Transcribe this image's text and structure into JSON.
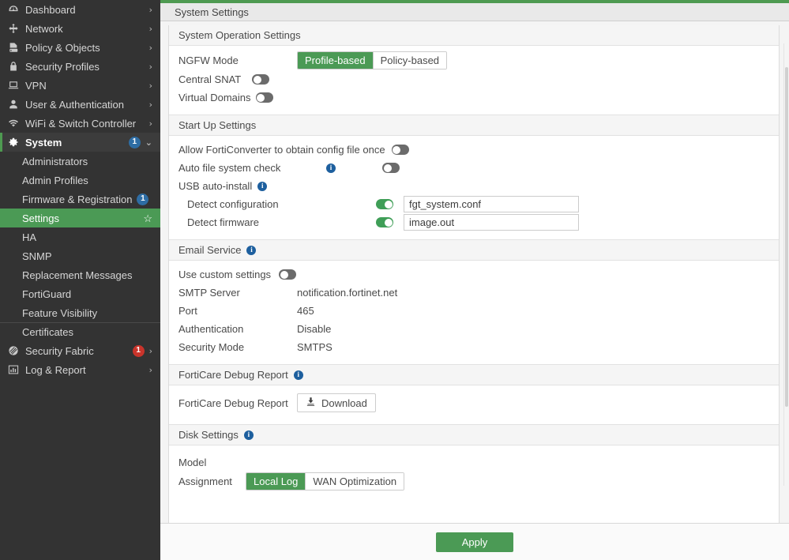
{
  "theme": {
    "brand_green": "#4b9a55",
    "sidebar_bg": "#333333",
    "badge_blue": "#2e6da4",
    "badge_red": "#c9342b",
    "info_blue": "#1d5f9e"
  },
  "sidebar": {
    "items": [
      {
        "label": "Dashboard",
        "icon": "dashboard-gauge-icon",
        "chevron": "›"
      },
      {
        "label": "Network",
        "icon": "network-arrows-icon",
        "chevron": "›"
      },
      {
        "label": "Policy & Objects",
        "icon": "policy-icon",
        "chevron": "›"
      },
      {
        "label": "Security Profiles",
        "icon": "lock-icon",
        "chevron": "›"
      },
      {
        "label": "VPN",
        "icon": "monitor-icon",
        "chevron": "›"
      },
      {
        "label": "User & Authentication",
        "icon": "user-icon",
        "chevron": "›"
      },
      {
        "label": "WiFi & Switch Controller",
        "icon": "wifi-icon",
        "chevron": "›"
      },
      {
        "label": "System",
        "icon": "gear-icon",
        "chevron": "⌄",
        "badge": "1",
        "badge_color": "blue",
        "open": true
      }
    ],
    "system_children": [
      {
        "label": "Administrators"
      },
      {
        "label": "Admin Profiles"
      },
      {
        "label": "Firmware & Registration",
        "badge": "1",
        "badge_color": "blue"
      },
      {
        "label": "Settings",
        "active": true,
        "star": "☆"
      },
      {
        "label": "HA"
      },
      {
        "label": "SNMP"
      },
      {
        "label": "Replacement Messages"
      },
      {
        "label": "FortiGuard"
      },
      {
        "label": "Feature Visibility"
      },
      {
        "label": "Certificates",
        "separator": true
      }
    ],
    "items_after": [
      {
        "label": "Security Fabric",
        "icon": "fabric-icon",
        "chevron": "›",
        "badge": "1",
        "badge_color": "red"
      },
      {
        "label": "Log & Report",
        "icon": "chart-bar-icon",
        "chevron": "›"
      }
    ]
  },
  "header": {
    "title": "System Settings"
  },
  "sections": {
    "system_operation": {
      "title": "System Operation Settings",
      "ngfw_mode": {
        "label": "NGFW Mode",
        "options": [
          "Profile-based",
          "Policy-based"
        ],
        "selected": "Profile-based"
      },
      "central_snat": {
        "label": "Central SNAT",
        "state": "off"
      },
      "virtual_domains": {
        "label": "Virtual Domains",
        "state": "off"
      }
    },
    "start_up": {
      "title": "Start Up Settings",
      "forticonverter": {
        "label": "Allow FortiConverter to obtain config file once",
        "state": "off"
      },
      "auto_file_check": {
        "label": "Auto file system check",
        "state": "off",
        "info": "i"
      },
      "usb_auto_install": {
        "label": "USB auto-install",
        "info": "i"
      },
      "detect_configuration": {
        "label": "Detect configuration",
        "state": "on",
        "value": "fgt_system.conf",
        "placeholder": ""
      },
      "detect_firmware": {
        "label": "Detect firmware",
        "state": "on",
        "value": "image.out",
        "placeholder": ""
      }
    },
    "email_service": {
      "title": "Email Service",
      "info": "i",
      "use_custom": {
        "label": "Use custom settings",
        "state": "off"
      },
      "fields": [
        {
          "label": "SMTP Server",
          "value": "notification.fortinet.net"
        },
        {
          "label": "Port",
          "value": "465"
        },
        {
          "label": "Authentication",
          "value": "Disable"
        },
        {
          "label": "Security Mode",
          "value": "SMTPS"
        }
      ]
    },
    "forticare_debug": {
      "title": "FortiCare Debug Report",
      "info": "i",
      "row_label": "FortiCare Debug Report",
      "button_label": "Download",
      "button_icon": "download-icon"
    },
    "disk_settings": {
      "title": "Disk Settings",
      "info": "i",
      "model": {
        "label": "Model",
        "value": ""
      },
      "assignment": {
        "label": "Assignment",
        "options": [
          "Local Log",
          "WAN Optimization"
        ],
        "selected": "Local Log"
      }
    }
  },
  "footer": {
    "apply_label": "Apply"
  }
}
